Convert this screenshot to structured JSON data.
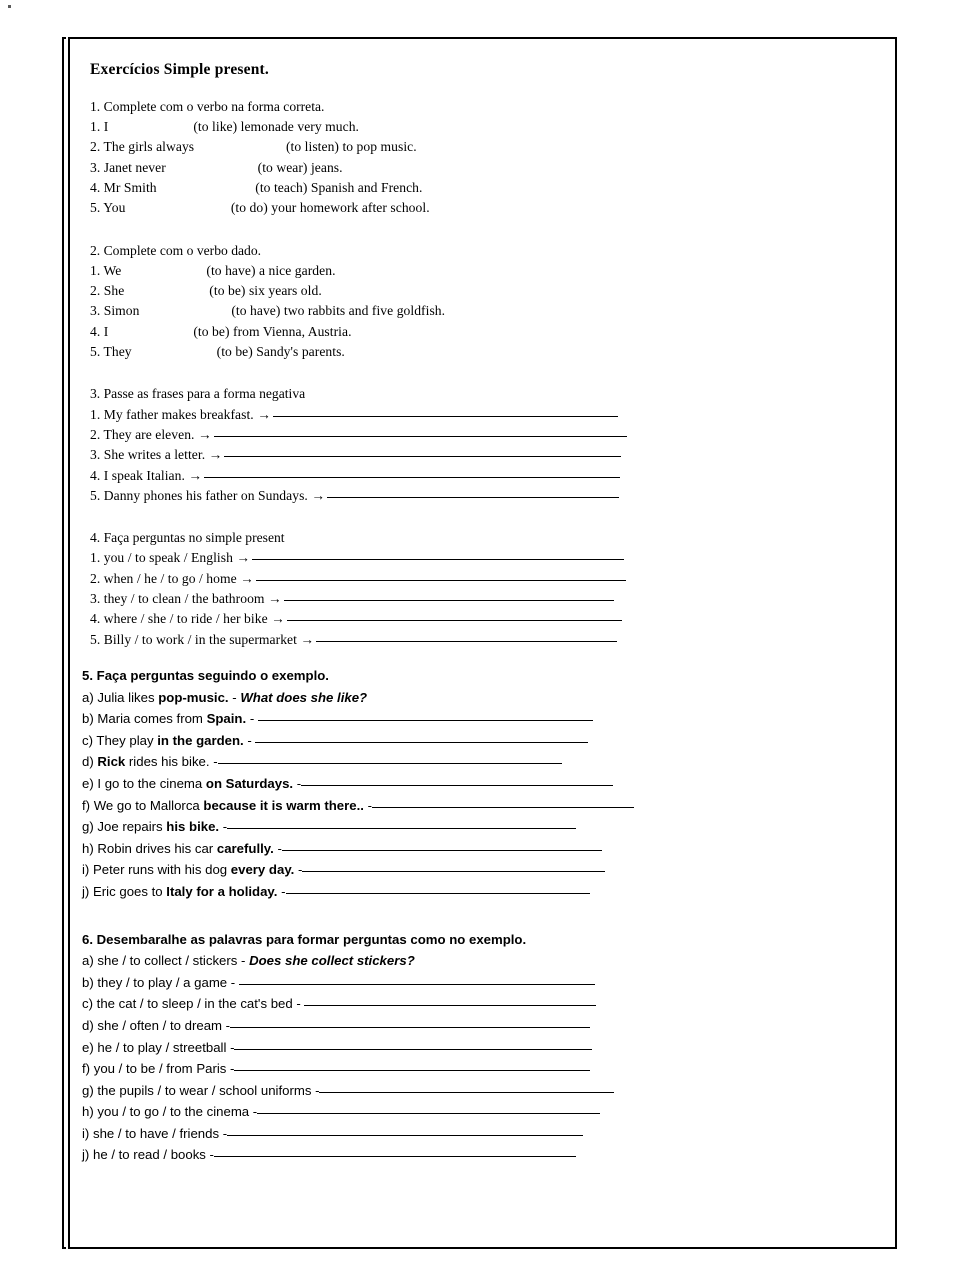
{
  "document": {
    "title": "Exercícios Simple present."
  },
  "sections": {
    "ex1": {
      "heading": "1. Complete com o verbo na forma correta.",
      "items": [
        {
          "pre": "1. I ",
          "blank": "____________",
          "post": "(to like) lemonade very much."
        },
        {
          "pre": "2. The girls always",
          "blank": "_____________",
          "post": " (to listen) to pop music."
        },
        {
          "pre": "3. Janet never ",
          "blank": "_____________",
          "post": "(to wear) jeans."
        },
        {
          "pre": "4. Mr Smith",
          "blank": "______________",
          "post": " (to teach) Spanish and French."
        },
        {
          "pre": "5. You ",
          "blank": "_______________",
          "post": "(to do) your homework after school."
        }
      ]
    },
    "ex2": {
      "heading": "2. Complete com o verbo dado.",
      "items": [
        {
          "pre": "1. We ",
          "blank": "____________",
          "post": "(to have) a nice garden."
        },
        {
          "pre": "2. She ",
          "blank": "____________",
          "post": "(to be) six years old."
        },
        {
          "pre": "3. Simon ",
          "blank": "_____________",
          "post": "(to have) two rabbits and five goldfish."
        },
        {
          "pre": "4. I ",
          "blank": "____________",
          "post": "(to be) from Vienna, Austria."
        },
        {
          "pre": "5. They ",
          "blank": "____________",
          "post": "(to be) Sandy's parents."
        }
      ]
    },
    "ex3": {
      "heading": "3. Passe as frases para a forma negativa",
      "arrow": "→",
      "items": [
        {
          "text": "1. My father makes breakfast.",
          "rule_width": 345
        },
        {
          "text": "2. They are eleven.",
          "rule_width": 413
        },
        {
          "text": "3. She writes a letter.",
          "rule_width": 397
        },
        {
          "text": "4. I speak Italian.",
          "rule_width": 416
        },
        {
          "text": "5. Danny phones his father on Sundays.",
          "rule_width": 292
        }
      ]
    },
    "ex4": {
      "heading": "4. Faça perguntas no simple present",
      "arrow": "→",
      "items": [
        {
          "text": "1. you / to speak / English",
          "rule_width": 372
        },
        {
          "text": "2. when / he / to go / home",
          "rule_width": 370
        },
        {
          "text": "3. they / to clean / the bathroom",
          "rule_width": 330
        },
        {
          "text": "4. where / she / to ride / her bike",
          "rule_width": 335
        },
        {
          "text": "5. Billy / to work / in the supermarket",
          "rule_width": 301
        }
      ]
    },
    "ex5": {
      "heading": "5. Faça perguntas seguindo o exemplo.",
      "items": [
        {
          "plain1": "a) Julia likes ",
          "bold": "pop-music.",
          "plain2": " - ",
          "italic": "What does she like?",
          "rule_width": 0
        },
        {
          "plain1": "b) Maria comes from ",
          "bold": "Spain.",
          "plain2": " - ",
          "italic": "",
          "rule_width": 335
        },
        {
          "plain1": "c) They play ",
          "bold": "in the garden.",
          "plain2": " - ",
          "italic": "",
          "rule_width": 333
        },
        {
          "plain1": "d) ",
          "bold": "Rick",
          "plain2": " rides his bike. -",
          "italic": "",
          "rule_width": 344
        },
        {
          "plain1": "e) I go to the cinema ",
          "bold": "on Saturdays.",
          "plain2": " -",
          "italic": "",
          "rule_width": 312
        },
        {
          "plain1": "f) We go to Mallorca ",
          "bold": "because it is warm there..",
          "plain2": " -",
          "italic": "",
          "rule_width": 262
        },
        {
          "plain1": "g) Joe repairs ",
          "bold": "his bike.",
          "plain2": " -",
          "italic": "",
          "rule_width": 349
        },
        {
          "plain1": "h) Robin drives his car ",
          "bold": "carefully.",
          "plain2": " -",
          "italic": "",
          "rule_width": 320
        },
        {
          "plain1": "i) Peter runs with his dog ",
          "bold": "every day.",
          "plain2": " -",
          "italic": "",
          "rule_width": 303
        },
        {
          "plain1": "j) Eric goes to ",
          "bold": "Italy for a holiday.",
          "plain2": " -",
          "italic": "",
          "rule_width": 304
        }
      ]
    },
    "ex6": {
      "heading": "6. Desembaralhe as palavras para formar perguntas como no exemplo.",
      "items": [
        {
          "plain1": "a) she / to collect / stickers - ",
          "italic": "Does she collect stickers?",
          "rule_width": 0
        },
        {
          "plain1": "b) they / to play / a game - ",
          "italic": "",
          "rule_width": 356
        },
        {
          "plain1": "c) the cat / to sleep / in the cat's bed - ",
          "italic": "",
          "rule_width": 292
        },
        {
          "plain1": "d) she / often / to dream -",
          "italic": "",
          "rule_width": 360
        },
        {
          "plain1": "e) he / to play / streetball -",
          "italic": "",
          "rule_width": 358
        },
        {
          "plain1": "f) you / to be / from Paris -",
          "italic": "",
          "rule_width": 356
        },
        {
          "plain1": "g) the pupils / to wear / school uniforms -",
          "italic": "",
          "rule_width": 295
        },
        {
          "plain1": "h) you / to go / to the cinema -",
          "italic": "",
          "rule_width": 343
        },
        {
          "plain1": "i) she / to have / friends -",
          "italic": "",
          "rule_width": 356
        },
        {
          "plain1": "j) he / to read / books -",
          "italic": "",
          "rule_width": 362
        }
      ]
    }
  }
}
